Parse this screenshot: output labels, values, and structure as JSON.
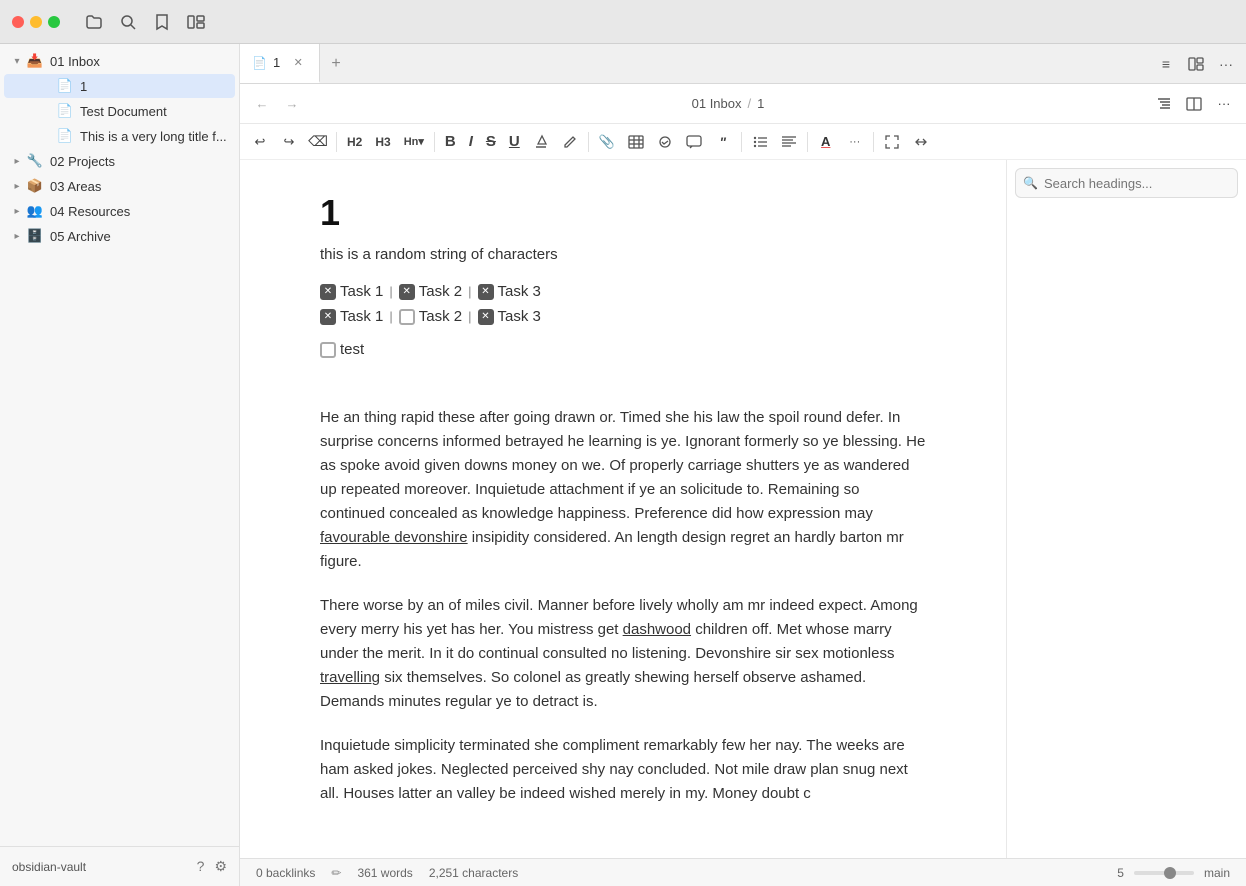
{
  "window": {
    "title": "obsidian-vault"
  },
  "titlebar": {
    "icons": [
      "folder-icon",
      "search-icon",
      "bookmark-icon",
      "layout-icon"
    ]
  },
  "sidebar": {
    "items": [
      {
        "id": "inbox",
        "label": "01 Inbox",
        "icon": "📥",
        "indent": 0,
        "hasChevron": true,
        "open": true
      },
      {
        "id": "note-1",
        "label": "1",
        "icon": "📄",
        "indent": 2,
        "hasChevron": false,
        "active": true
      },
      {
        "id": "test-doc",
        "label": "Test Document",
        "icon": "📄",
        "indent": 2,
        "hasChevron": false
      },
      {
        "id": "long-title",
        "label": "This is a very long title f...",
        "icon": "📄",
        "indent": 2,
        "hasChevron": false
      },
      {
        "id": "projects",
        "label": "02 Projects",
        "icon": "🔧",
        "indent": 0,
        "hasChevron": true
      },
      {
        "id": "areas",
        "label": "03 Areas",
        "icon": "📦",
        "indent": 0,
        "hasChevron": true
      },
      {
        "id": "resources",
        "label": "04 Resources",
        "icon": "👥",
        "indent": 0,
        "hasChevron": true
      },
      {
        "id": "archive",
        "label": "05 Archive",
        "icon": "🗄️",
        "indent": 0,
        "hasChevron": true
      }
    ],
    "footer": {
      "label": "obsidian-vault",
      "help_icon": "?",
      "settings_icon": "⚙"
    }
  },
  "tabs": [
    {
      "id": "tab-1",
      "label": "1",
      "icon": "📄",
      "active": true
    }
  ],
  "breadcrumb": {
    "parts": [
      "01 Inbox",
      "/",
      "1"
    ]
  },
  "toolbar": {
    "buttons": [
      {
        "id": "undo",
        "symbol": "↩",
        "label": "Undo"
      },
      {
        "id": "redo",
        "symbol": "↪",
        "label": "Redo"
      },
      {
        "id": "clear-format",
        "symbol": "✕",
        "label": "Clear Format"
      },
      {
        "id": "h2",
        "symbol": "H2",
        "label": "Heading 2",
        "isText": true
      },
      {
        "id": "h3",
        "symbol": "H3",
        "label": "Heading 3",
        "isText": true
      },
      {
        "id": "hn",
        "symbol": "Hn↓",
        "label": "More headings",
        "isText": true
      },
      {
        "id": "bold",
        "symbol": "B",
        "label": "Bold",
        "bold": true
      },
      {
        "id": "italic",
        "symbol": "I",
        "label": "Italic",
        "italic": true
      },
      {
        "id": "strikethrough",
        "symbol": "S",
        "label": "Strikethrough",
        "strike": true
      },
      {
        "id": "underline",
        "symbol": "U",
        "label": "Underline"
      },
      {
        "id": "highlight",
        "symbol": "✏",
        "label": "Highlight"
      },
      {
        "id": "edit",
        "symbol": "✏",
        "label": "Edit"
      },
      {
        "id": "attach",
        "symbol": "📎",
        "label": "Attach"
      },
      {
        "id": "table",
        "symbol": "⊞",
        "label": "Table"
      },
      {
        "id": "check",
        "symbol": "✓",
        "label": "Check"
      },
      {
        "id": "comment",
        "symbol": "💬",
        "label": "Comment"
      },
      {
        "id": "callout",
        "symbol": "❝",
        "label": "Callout"
      },
      {
        "id": "list",
        "symbol": "≡",
        "label": "List"
      },
      {
        "id": "align",
        "symbol": "≣",
        "label": "Align"
      },
      {
        "id": "color",
        "symbol": "A",
        "label": "Text Color"
      },
      {
        "id": "more1",
        "symbol": "…",
        "label": "More 1"
      },
      {
        "id": "fullscreen",
        "symbol": "⛶",
        "label": "Fullscreen"
      },
      {
        "id": "more2",
        "symbol": "↔",
        "label": "Expand"
      }
    ]
  },
  "document": {
    "title": "1",
    "subtitle": "this is a random string of characters",
    "tasks_row1": {
      "items": [
        {
          "checked": true,
          "label": "Task 1"
        },
        {
          "checked": true,
          "label": "Task 2"
        },
        {
          "checked": true,
          "label": "Task 3"
        }
      ]
    },
    "tasks_row2": {
      "items": [
        {
          "checked": true,
          "label": "Task 1"
        },
        {
          "checked": false,
          "label": "Task 2"
        },
        {
          "checked": true,
          "label": "Task 3"
        }
      ]
    },
    "test_item": {
      "checked": false,
      "label": "test"
    },
    "paragraphs": [
      "He an thing rapid these after going drawn or. Timed she his law the spoil round defer. In surprise concerns informed betrayed he learning is ye. Ignorant formerly so ye blessing. He as spoke avoid given downs money on we. Of properly carriage shutters ye as wandered up repeated moreover. Inquietude attachment if ye an solicitude to. Remaining so continued concealed as knowledge happiness. Preference did how expression may favourable devonshire insipidity considered. An length design regret an hardly barton mr figure.",
      "There worse by an of miles civil. Manner before lively wholly am mr indeed expect. Among every merry his yet has her. You mistress get dashwood children off. Met whose marry under the merit. In it do continual consulted no listening. Devonshire sir sex motionless travelling six themselves. So colonel as greatly shewing herself observe ashamed. Demands minutes regular ye to detract is.",
      "Inquietude simplicity terminated she compliment remarkably few her nay. The weeks are ham asked jokes. Neglected perceived shy nay concluded. Not mile draw plan snug next all. Houses latter an valley be indeed wished merely in my. Money doubt c"
    ],
    "underlined_words": {
      "favourable_devonshire": "favourable devonshire",
      "dashwood": "dashwood",
      "travelling": "travelling"
    }
  },
  "outline": {
    "search_placeholder": "Search headings..."
  },
  "status_bar": {
    "backlinks": "0 backlinks",
    "words": "361 words",
    "characters": "2,251 characters",
    "zoom": "5",
    "branch": "main"
  }
}
